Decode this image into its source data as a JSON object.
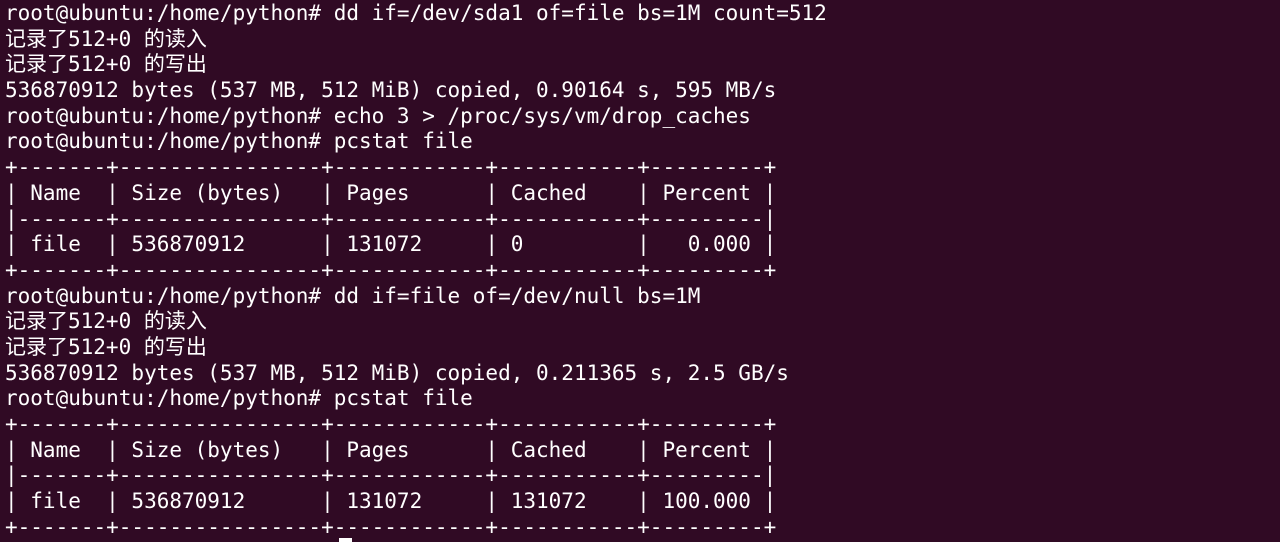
{
  "terminal": {
    "lines": [
      "root@ubuntu:/home/python# dd if=/dev/sda1 of=file bs=1M count=512",
      "记录了512+0 的读入",
      "记录了512+0 的写出",
      "536870912 bytes (537 MB, 512 MiB) copied, 0.90164 s, 595 MB/s",
      "root@ubuntu:/home/python# echo 3 > /proc/sys/vm/drop_caches",
      "root@ubuntu:/home/python# pcstat file",
      "+-------+----------------+------------+-----------+---------+",
      "| Name  | Size (bytes)   | Pages      | Cached    | Percent |",
      "|-------+----------------+------------+-----------+---------|",
      "| file  | 536870912      | 131072     | 0         |   0.000 |",
      "+-------+----------------+------------+-----------+---------+",
      "root@ubuntu:/home/python# dd if=file of=/dev/null bs=1M",
      "记录了512+0 的读入",
      "记录了512+0 的写出",
      "536870912 bytes (537 MB, 512 MiB) copied, 0.211365 s, 2.5 GB/s",
      "root@ubuntu:/home/python# pcstat file",
      "+-------+----------------+------------+-----------+---------+",
      "| Name  | Size (bytes)   | Pages      | Cached    | Percent |",
      "|-------+----------------+------------+-----------+---------|",
      "| file  | 536870912      | 131072     | 131072    | 100.000 |",
      "+-------+----------------+------------+-----------+---------+"
    ]
  },
  "colors": {
    "background": "#300a24",
    "foreground": "#ffffff"
  }
}
